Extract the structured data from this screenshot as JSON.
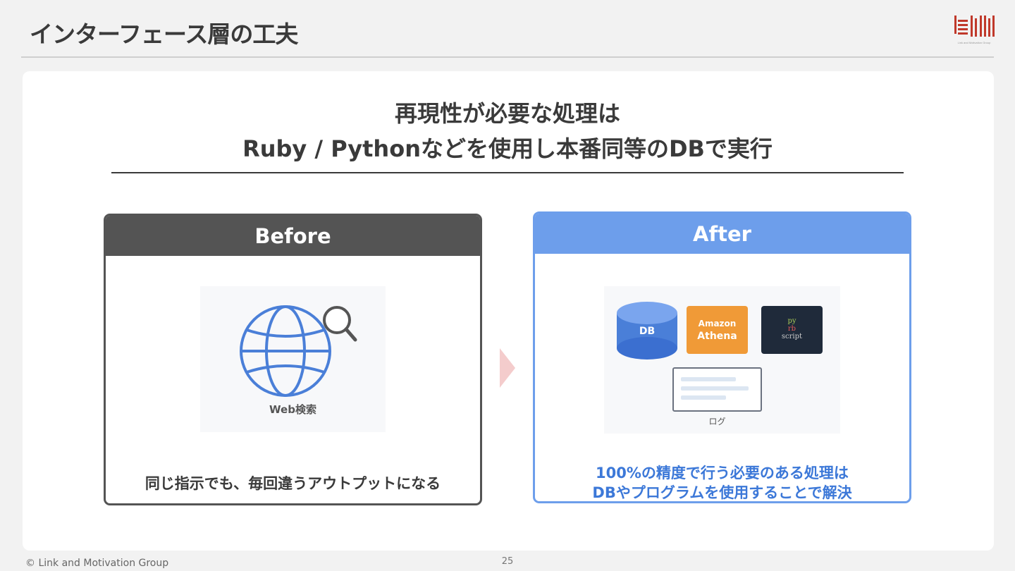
{
  "header": {
    "title": "インターフェース層の工夫",
    "logo_caption": "Link and Motivation Group"
  },
  "headline": {
    "line1": "再現性が必要な処理は",
    "line2": "Ruby / Pythonなどを使用し本番同等のDBで実行"
  },
  "before": {
    "label": "Before",
    "illustration_label": "Web検索",
    "caption": "同じ指示でも、毎回違うアウトプットになる"
  },
  "after": {
    "label": "After",
    "db_label": "DB",
    "athena_line1": "Amazon",
    "athena_line2": "Athena",
    "code_lines": [
      "py",
      "rb",
      "script"
    ],
    "log_label": "ログ",
    "caption_line1": "100%の精度で行う必要のある処理は",
    "caption_line2": "DBやプログラムを使用することで解決"
  },
  "footer": {
    "copyright": "© Link and Motivation Group",
    "page_number": "25"
  },
  "colors": {
    "before_header": "#545454",
    "after_header": "#6d9eeb",
    "after_caption": "#3c78d8",
    "arrow": "#f4cccc",
    "athena": "#f09a37",
    "logo_red": "#c0392b"
  }
}
